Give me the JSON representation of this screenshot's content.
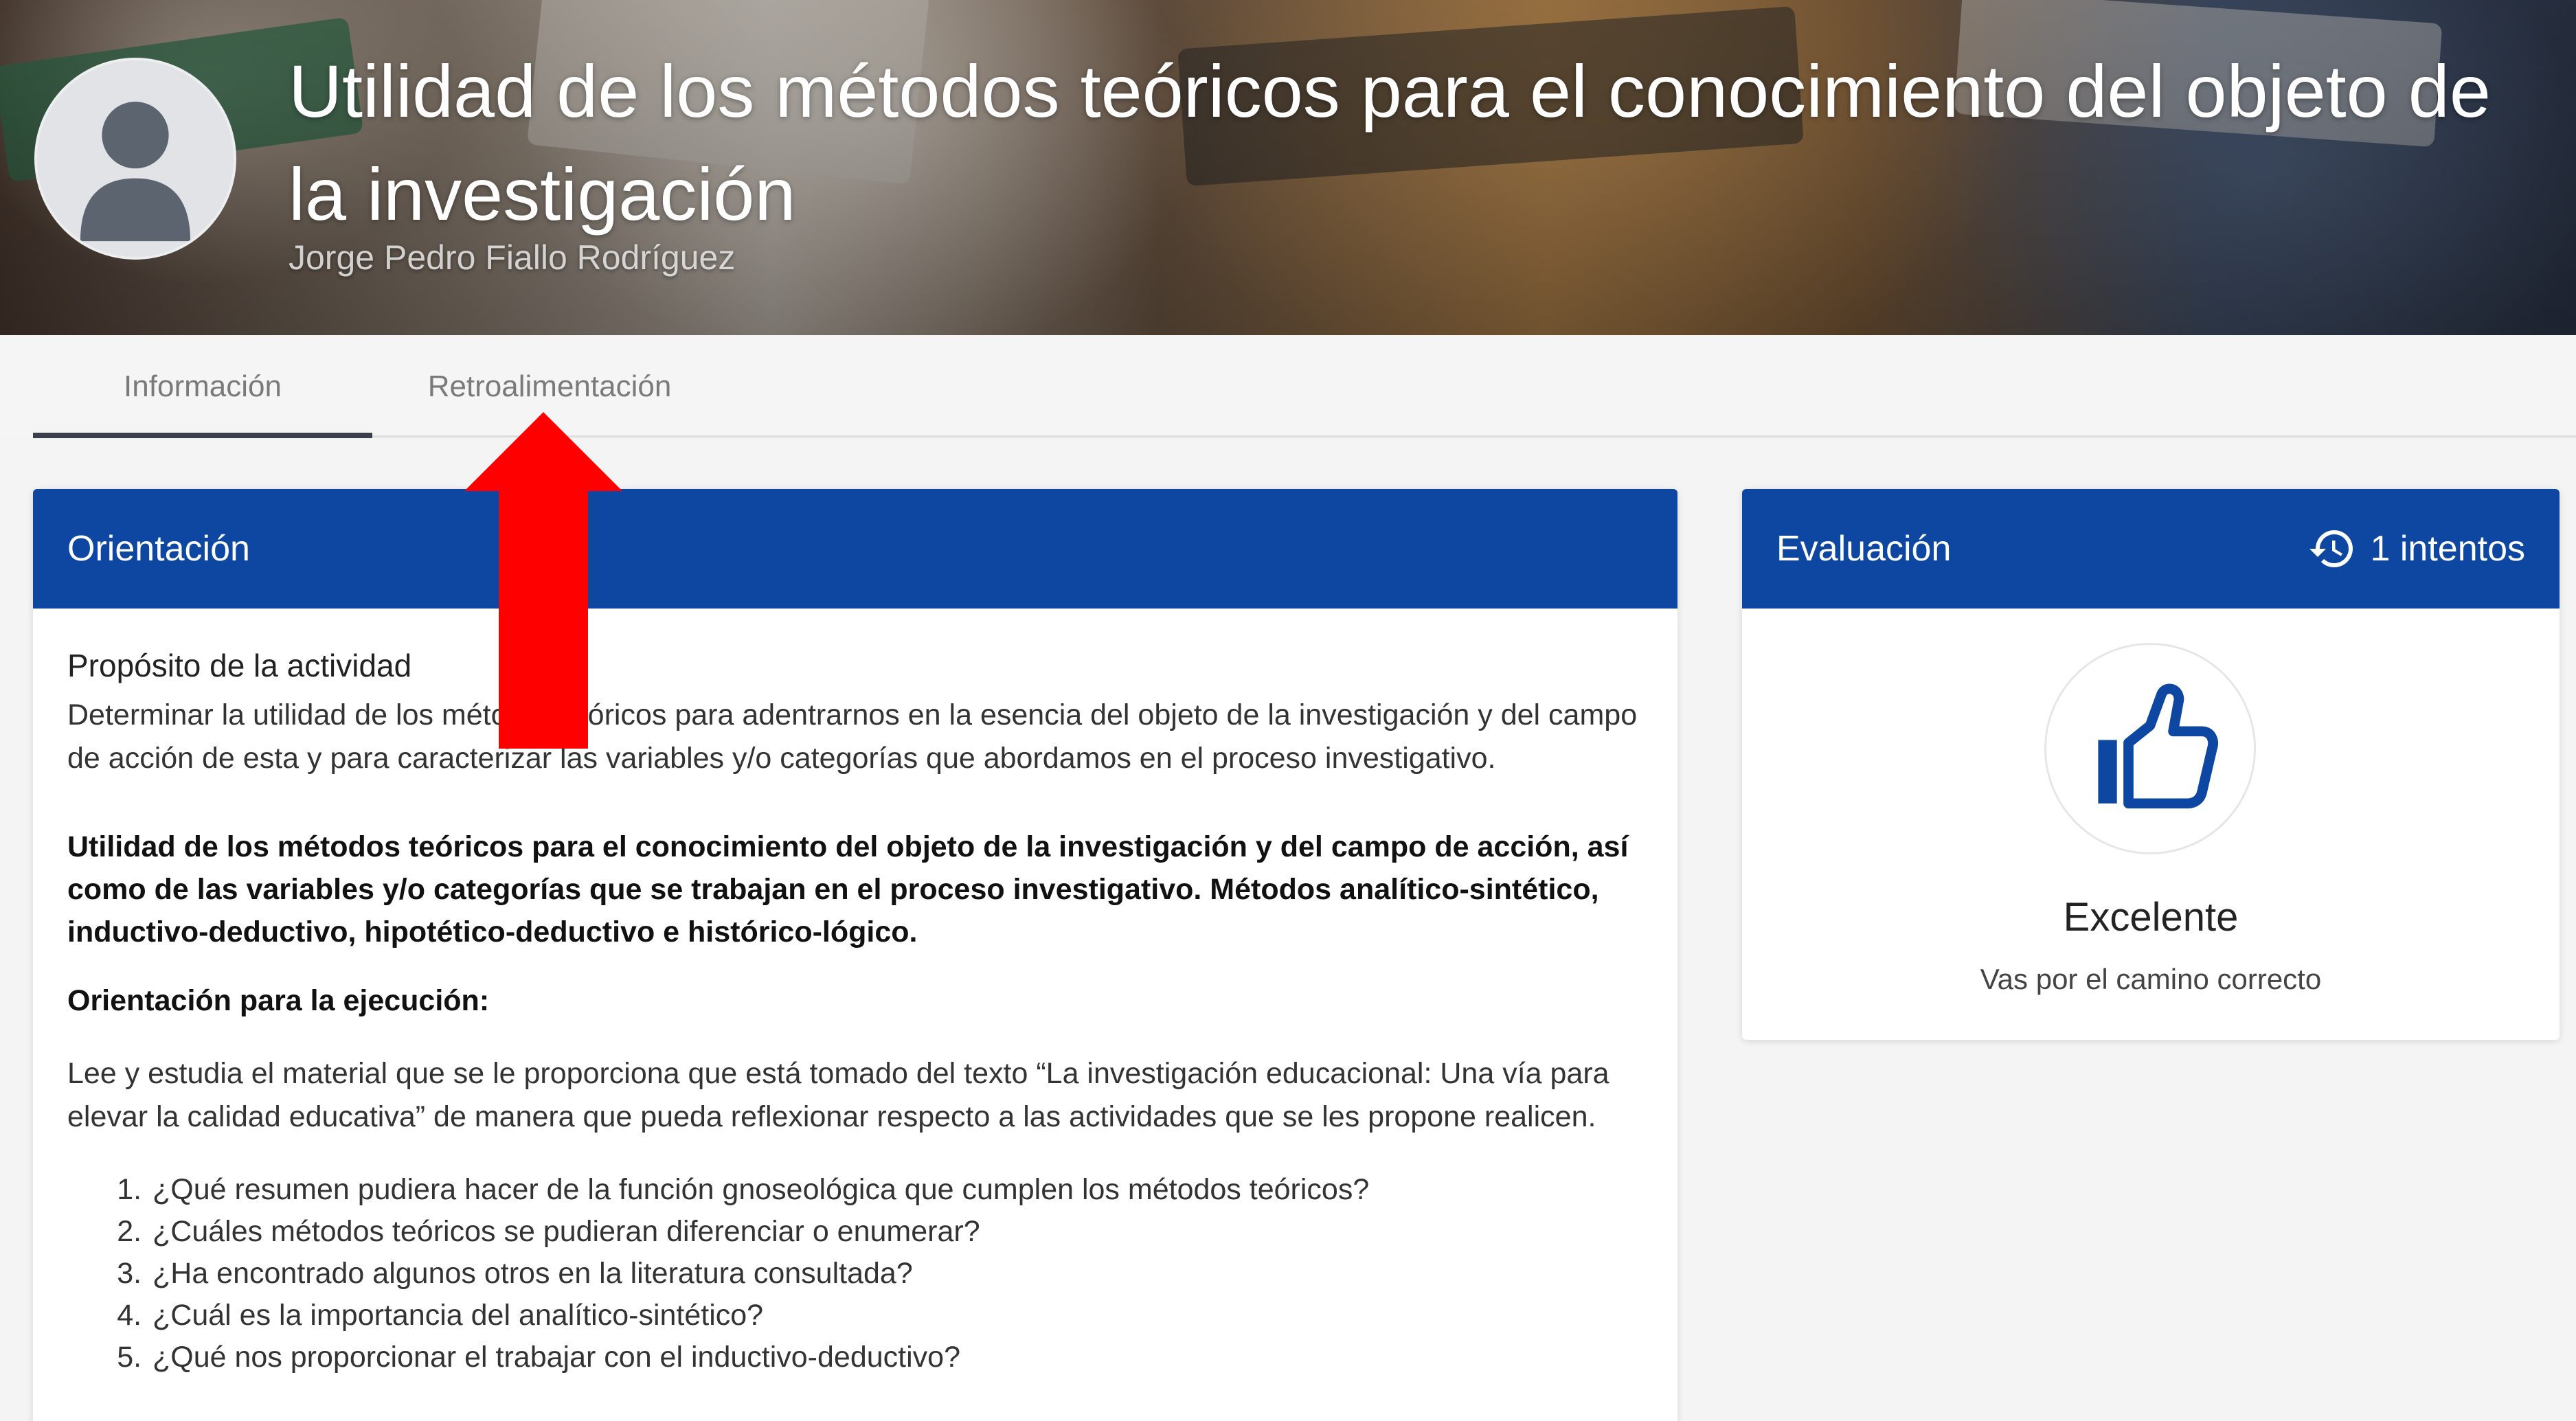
{
  "header": {
    "title": "Utilidad de los métodos teóricos para el conocimiento del objeto de la investigación",
    "author": "Jorge Pedro Fiallo Rodríguez"
  },
  "tabs": [
    {
      "label": "Información",
      "active": true
    },
    {
      "label": "Retroalimentación",
      "active": false
    }
  ],
  "orientation": {
    "heading": "Orientación",
    "purpose_title": "Propósito de la actividad",
    "purpose_text": "Determinar la utilidad de los métodos teóricos para adentrarnos en la esencia del objeto de la investigación y del campo de acción de esta y para caracterizar las variables y/o categorías que abordamos en el proceso investigativo.",
    "bold_text": "Utilidad de los métodos teóricos para el conocimiento del objeto de la investigación y del campo de acción, así como de las variables y/o categorías que se trabajan en el proceso investigativo. Métodos analítico-sintético, inductivo-deductivo, hipotético-deductivo e histórico-lógico.",
    "execution_title": "Orientación para la ejecución:",
    "read_text": "Lee y estudia el material que se le proporciona que está tomado del texto  “La investigación educacional: Una vía para elevar la calidad educativa” de manera que pueda reflexionar respecto a las actividades que se les propone realicen.",
    "questions": [
      "¿Qué resumen pudiera hacer de la función gnoseológica que cumplen los métodos teóricos?",
      "¿Cuáles métodos teóricos se pudieran diferenciar o enumerar?",
      "¿Ha encontrado algunos otros en la literatura consultada?",
      "¿Cuál es la importancia del analítico-sintético?",
      "¿Qué nos proporcionar el trabajar con el inductivo-deductivo?"
    ]
  },
  "evaluation": {
    "heading": "Evaluación",
    "attempts": "1 intentos",
    "result": "Excelente",
    "message": "Vas por el camino correcto"
  },
  "colors": {
    "primary": "#0d47a1",
    "annotation_arrow": "#ff0000"
  },
  "icons": {
    "attempts": "history-icon",
    "result": "thumbs-up-icon",
    "avatar": "user-silhouette-icon"
  }
}
